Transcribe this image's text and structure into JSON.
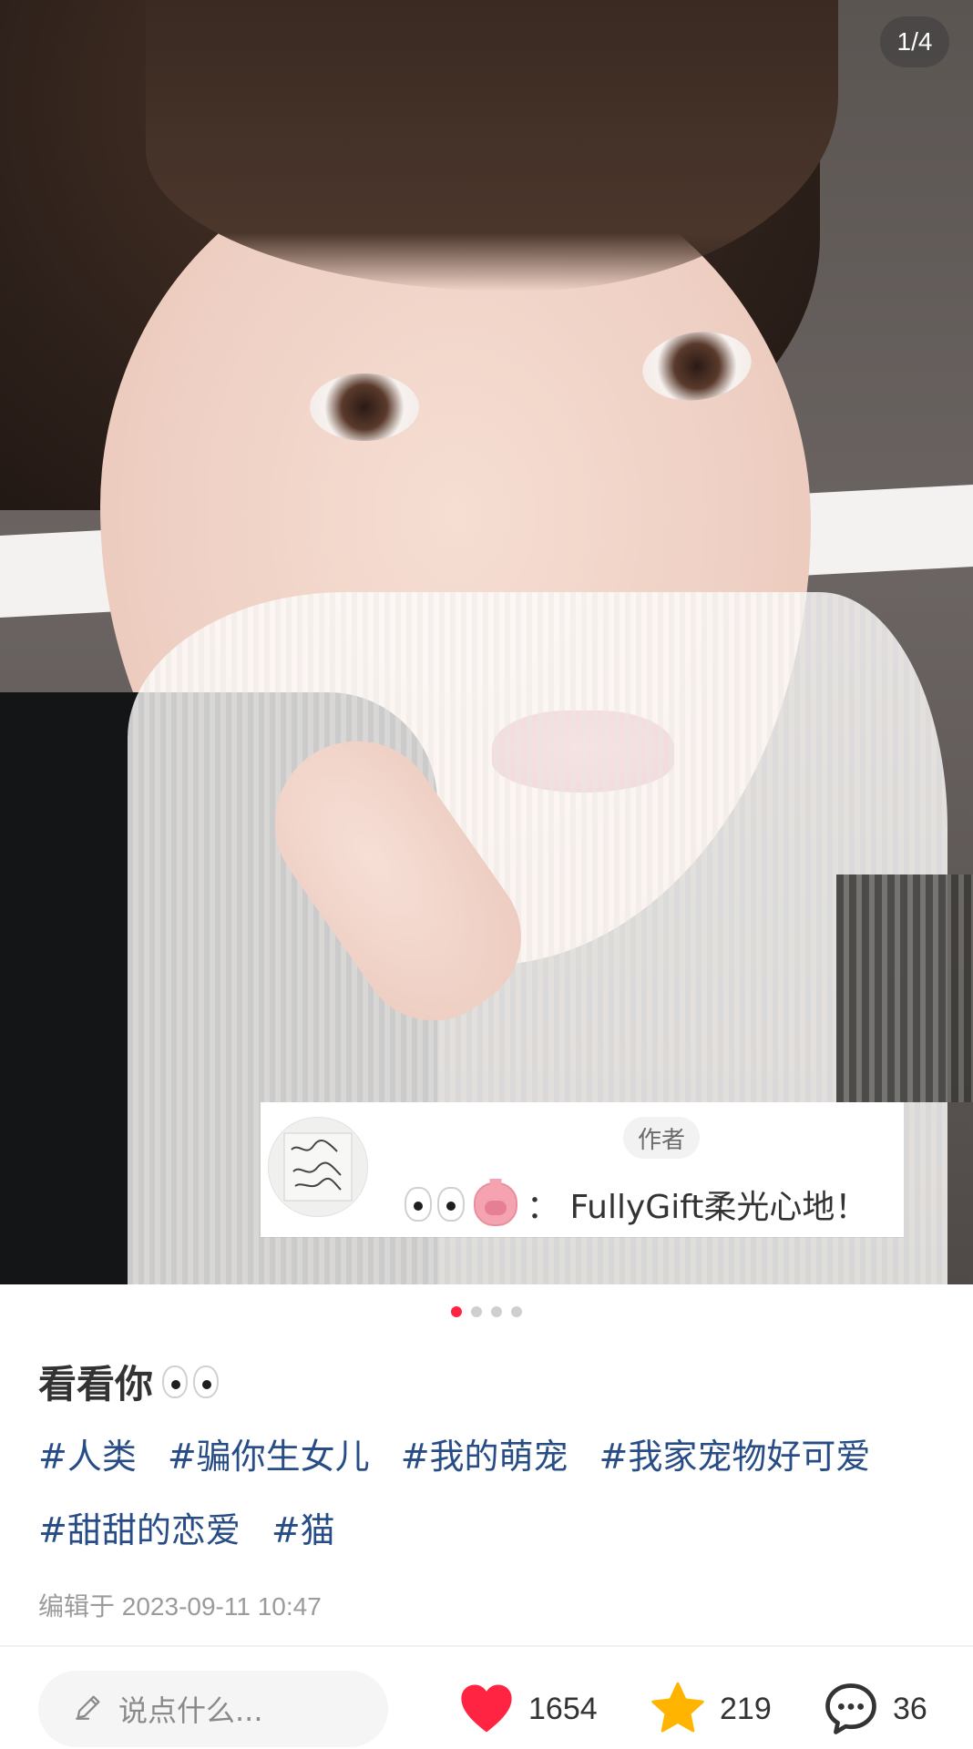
{
  "photo": {
    "page_indicator": "1/4",
    "pinned_comment": {
      "author_tag": "作者",
      "text": "：  FullyGift柔光心地！",
      "emoji_names": [
        "eyes-emoji",
        "pig-face-emoji"
      ]
    }
  },
  "carousel": {
    "total": 4,
    "active_index": 0
  },
  "post": {
    "title": "看看你",
    "tags": [
      "#人类",
      "#骗你生女儿",
      "#我的萌宠",
      "#我家宠物好可爱",
      "#甜甜的恋爱",
      "#猫"
    ],
    "edited_time": "编辑于 2023-09-11 10:47"
  },
  "bottom_bar": {
    "input_placeholder": "说点什么...",
    "likes": "1654",
    "stars": "219",
    "comments": "36"
  },
  "colors": {
    "accent": "#ff2442",
    "tag_text": "#284d86",
    "heart": "#ff2442",
    "star": "#ffb400"
  },
  "icons": [
    "pencil-icon",
    "heart-icon",
    "star-icon",
    "comment-bubble-icon"
  ]
}
